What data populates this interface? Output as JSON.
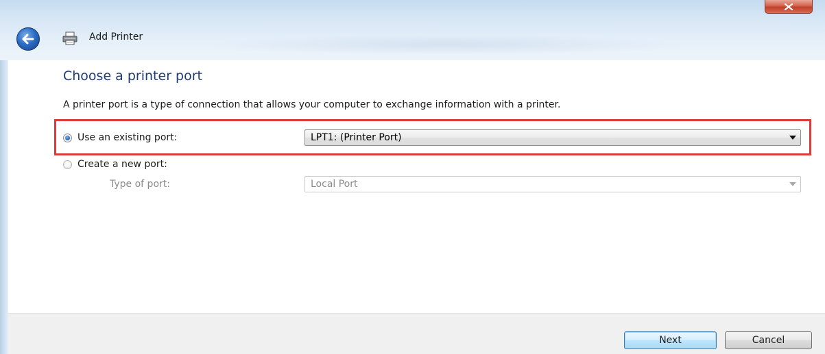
{
  "window": {
    "title": "Add Printer",
    "close_glyph": "x"
  },
  "page": {
    "heading": "Choose a printer port",
    "description": "A printer port is a type of connection that allows your computer to exchange information with a printer."
  },
  "options": {
    "existing": {
      "label": "Use an existing port:",
      "selected": true,
      "dropdown_value": "LPT1: (Printer Port)"
    },
    "new_port": {
      "label": "Create a new port:",
      "selected": false,
      "type_label": "Type of port:",
      "dropdown_value": "Local Port"
    }
  },
  "buttons": {
    "next": "Next",
    "cancel": "Cancel"
  },
  "colors": {
    "heading": "#1f3b78",
    "highlight_border": "#d83c3c",
    "close_button": "#c3402a"
  },
  "icons": {
    "back": "back-arrow-icon",
    "printer": "printer-icon",
    "close": "close-icon",
    "dropdown": "chevron-down-icon"
  }
}
